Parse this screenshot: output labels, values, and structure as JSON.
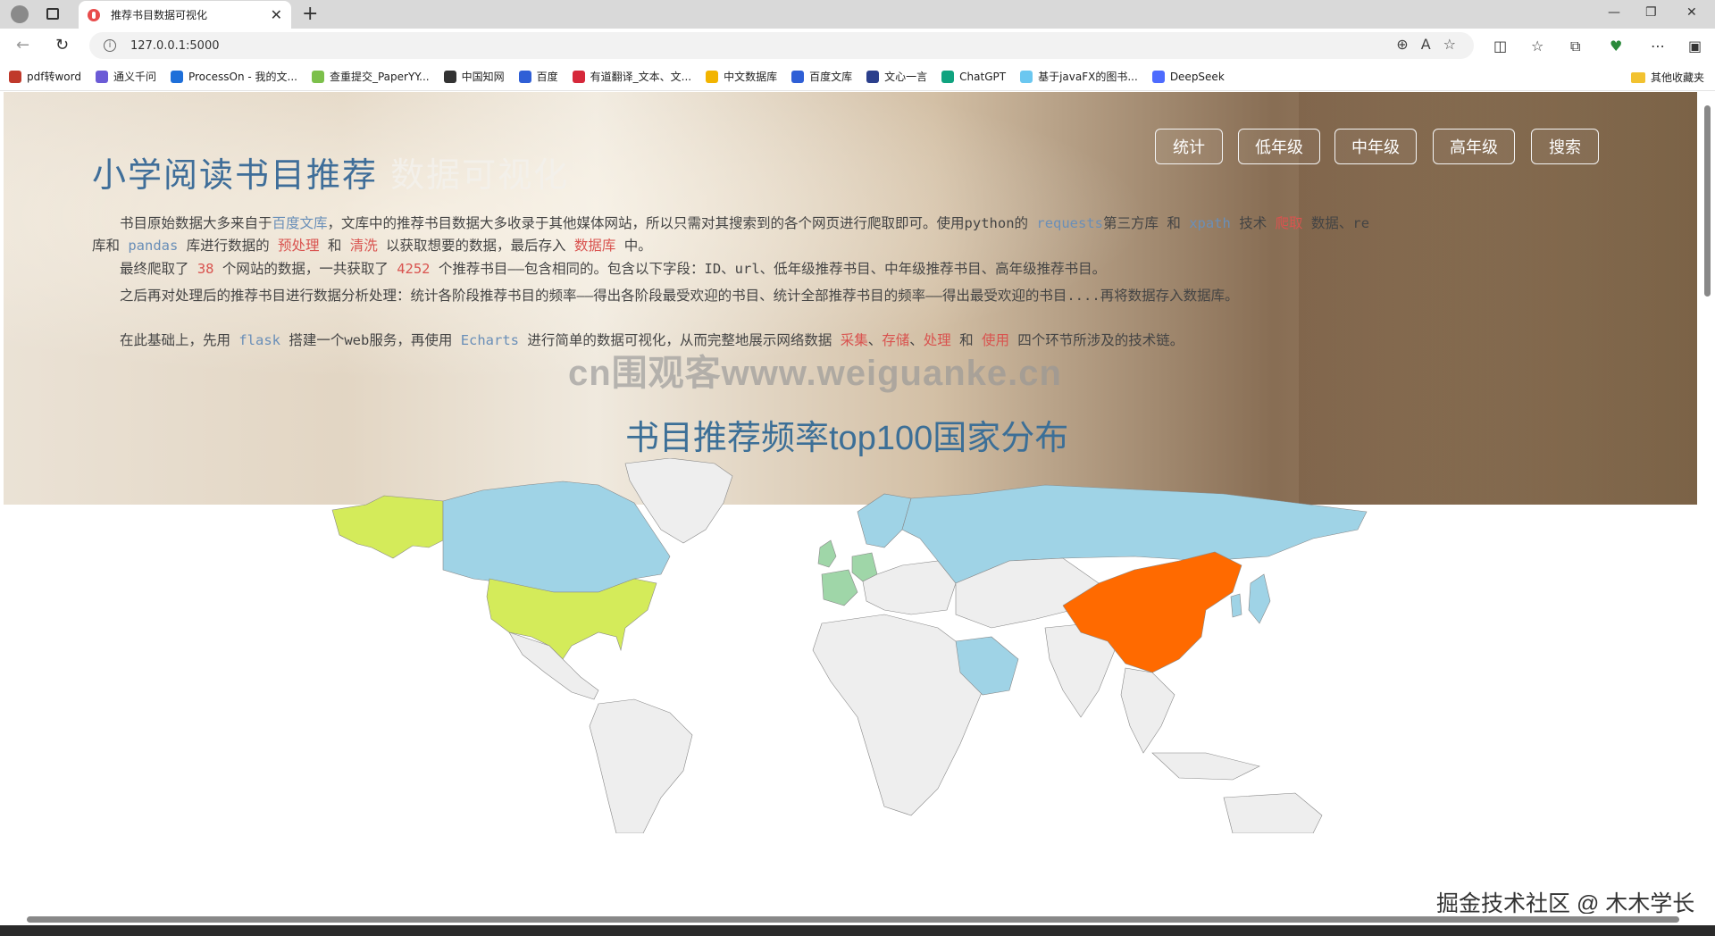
{
  "browser": {
    "tab_title": "推荐书目数据可视化",
    "url": "127.0.0.1:5000",
    "bookmarks": [
      {
        "label": "pdf转word",
        "color": "#c0392b"
      },
      {
        "label": "通义千问",
        "color": "#6b5bd6"
      },
      {
        "label": "ProcessOn - 我的文...",
        "color": "#1e6fd9"
      },
      {
        "label": "查重提交_PaperYY...",
        "color": "#7cc04b"
      },
      {
        "label": "中国知网",
        "color": "#333333"
      },
      {
        "label": "百度",
        "color": "#2f5fd6"
      },
      {
        "label": "有道翻译_文本、文...",
        "color": "#d6283a"
      },
      {
        "label": "中文数据库",
        "color": "#f2b400"
      },
      {
        "label": "百度文库",
        "color": "#2f5fd6"
      },
      {
        "label": "文心一言",
        "color": "#2b3f8c"
      },
      {
        "label": "ChatGPT",
        "color": "#10a37f"
      },
      {
        "label": "基于javaFX的图书...",
        "color": "#6bc7f0"
      },
      {
        "label": "DeepSeek",
        "color": "#4d6bfe"
      }
    ],
    "other_bookmarks": "其他收藏夹"
  },
  "hero": {
    "title_a": "小学阅读书目推荐",
    "title_b": "数据可视化",
    "nav": [
      "统计",
      "低年级",
      "中年级",
      "高年级",
      "搜索"
    ],
    "p1": [
      {
        "t": "书目原始数据大多来自于",
        "c": ""
      },
      {
        "t": "百度文库",
        "c": "blue"
      },
      {
        "t": "，文库中的推荐书目数据大多收录于其他媒体网站，所以只需对其搜索到的各个网页进行爬取即可。使用python的 ",
        "c": ""
      },
      {
        "t": "requests",
        "c": "blue"
      },
      {
        "t": "第三方库 和 ",
        "c": ""
      },
      {
        "t": "xpath",
        "c": "blue"
      },
      {
        "t": " 技术 ",
        "c": ""
      },
      {
        "t": "爬取",
        "c": "red"
      },
      {
        "t": " 数据、re库和 ",
        "c": ""
      },
      {
        "t": "pandas",
        "c": "blue"
      },
      {
        "t": " 库进行数据的 ",
        "c": ""
      },
      {
        "t": "预处理",
        "c": "red"
      },
      {
        "t": " 和 ",
        "c": ""
      },
      {
        "t": "清洗",
        "c": "red"
      },
      {
        "t": " 以获取想要的数据，最后存入 ",
        "c": ""
      },
      {
        "t": "数据库",
        "c": "red"
      },
      {
        "t": " 中。",
        "c": ""
      }
    ],
    "p2": [
      {
        "t": "最终爬取了 ",
        "c": ""
      },
      {
        "t": "38",
        "c": "red"
      },
      {
        "t": " 个网站的数据，一共获取了 ",
        "c": ""
      },
      {
        "t": "4252",
        "c": "red"
      },
      {
        "t": " 个推荐书目——包含相同的。包含以下字段：ID、url、低年级推荐书目、中年级推荐书目、高年级推荐书目。",
        "c": ""
      }
    ],
    "p3": [
      {
        "t": "之后再对处理后的推荐书目进行数据分析处理：统计各阶段推荐书目的频率——得出各阶段最受欢迎的书目、统计全部推荐书目的频率——得出最受欢迎的书目....再将数据存入数据库。",
        "c": ""
      }
    ],
    "p4": [
      {
        "t": "在此基础上，先用 ",
        "c": ""
      },
      {
        "t": "flask",
        "c": "blue"
      },
      {
        "t": " 搭建一个web服务，再使用 ",
        "c": ""
      },
      {
        "t": "Echarts",
        "c": "blue"
      },
      {
        "t": " 进行简单的数据可视化，从而完整地展示网络数据 ",
        "c": ""
      },
      {
        "t": "采集",
        "c": "red"
      },
      {
        "t": "、",
        "c": ""
      },
      {
        "t": "存储",
        "c": "red"
      },
      {
        "t": "、",
        "c": ""
      },
      {
        "t": "处理",
        "c": "red"
      },
      {
        "t": " 和 ",
        "c": ""
      },
      {
        "t": "使用",
        "c": "red"
      },
      {
        "t": " 四个环节所涉及的技术链。",
        "c": ""
      }
    ],
    "watermark": "cn围观客www.weiguanke.cn"
  },
  "map": {
    "title": "书目推荐频率top100国家分布",
    "colors": {
      "china": "#ff6a00",
      "usa": "#d4eb5a",
      "alaska": "#d4eb5a",
      "light_blue": "#9fd3e6",
      "green": "#9fd6a8",
      "none": "#eeeeee"
    }
  },
  "corner_watermark": "掘金技术社区 @ 木木学长"
}
